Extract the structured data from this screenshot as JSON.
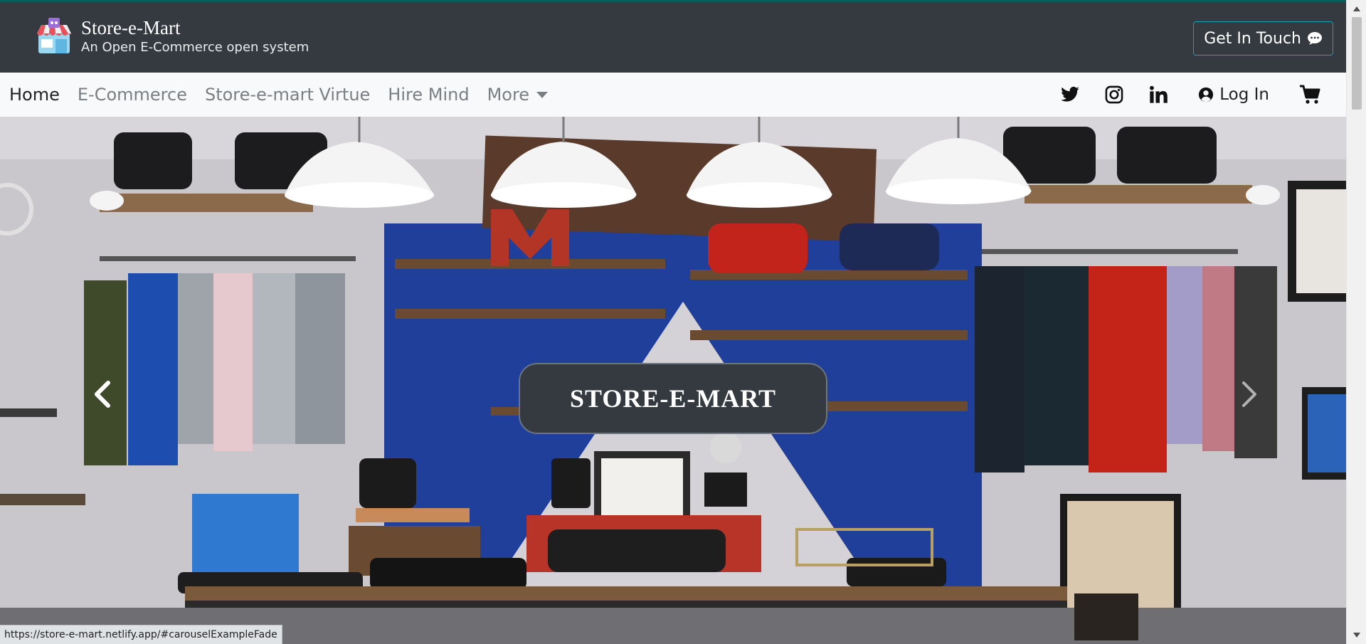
{
  "brand": {
    "name": "Store-e-Mart",
    "tagline": "An Open E-Commerce open system"
  },
  "header": {
    "contact_label": "Get In Touch"
  },
  "nav": {
    "items": [
      {
        "label": "Home",
        "active": true
      },
      {
        "label": "E-Commerce",
        "active": false
      },
      {
        "label": "Store-e-mart Virtue",
        "active": false
      },
      {
        "label": "Hire Mind",
        "active": false
      },
      {
        "label": "More",
        "active": false,
        "dropdown": true
      }
    ],
    "social_icons": [
      "twitter-icon",
      "instagram-icon",
      "linkedin-icon"
    ],
    "login_label": "Log In",
    "cart_icon": "shopping-cart-icon"
  },
  "carousel": {
    "caption": "STORE-E-MART",
    "prev_icon": "chevron-left-icon",
    "next_icon": "chevron-right-icon"
  },
  "status": {
    "url": "https://store-e-mart.netlify.app/#carouselExampleFade"
  },
  "colors": {
    "header_bg": "#343a40",
    "nav_bg": "#f8f9fa",
    "accent": "#17a2b8",
    "top_border": "#0d5c5c"
  }
}
